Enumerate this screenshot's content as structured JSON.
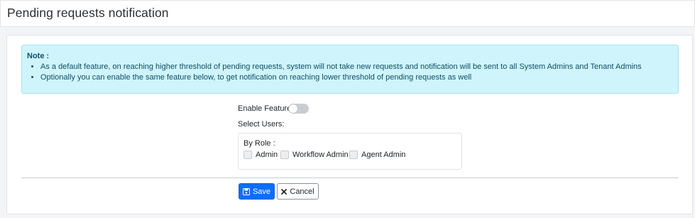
{
  "header": {
    "title": "Pending requests notification"
  },
  "note": {
    "title": "Note :",
    "items": [
      "As a default feature, on reaching higher threshold of pending requests, system will not take new requests and notification will be sent to all System Admins and Tenant Admins",
      "Optionally you can enable the same feature below, to get notification on reaching lower threshold of pending requests as well"
    ]
  },
  "form": {
    "enable_feature_label": "Enable Feature:",
    "enable_feature_on": false,
    "select_users_label": "Select Users:",
    "by_role_label": "By Role :",
    "roles": [
      {
        "label": "Admin",
        "checked": false
      },
      {
        "label": "Workflow Admin",
        "checked": false
      },
      {
        "label": "Agent Admin",
        "checked": false
      }
    ]
  },
  "actions": {
    "save_label": "Save",
    "cancel_label": "Cancel"
  },
  "colors": {
    "primary": "#0d6efd",
    "note_bg": "#cff4fc",
    "note_text": "#0d4f63"
  }
}
